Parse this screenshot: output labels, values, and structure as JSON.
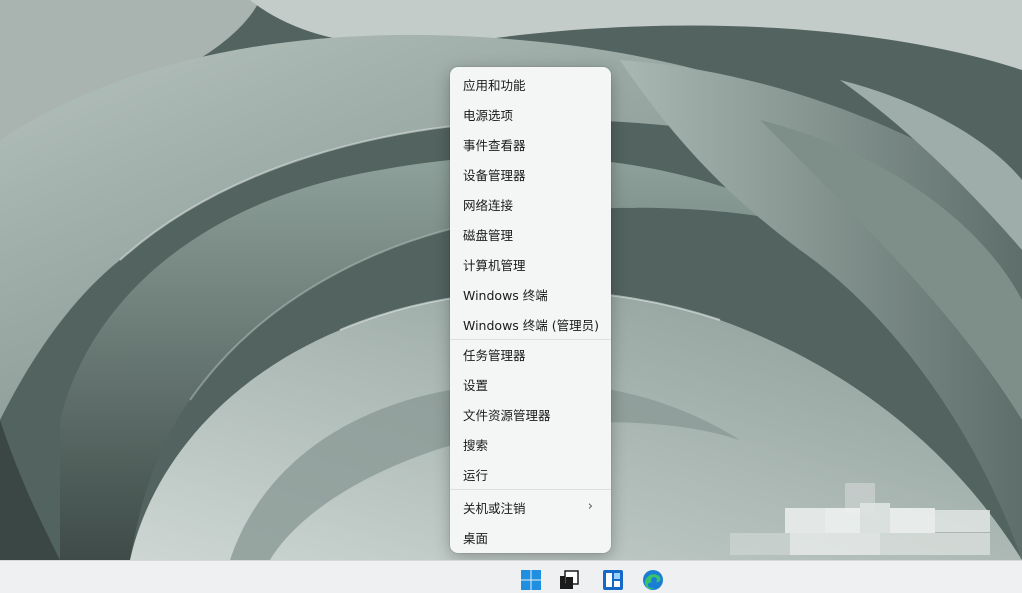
{
  "menu": {
    "items": [
      {
        "label": "应用和功能"
      },
      {
        "label": "电源选项"
      },
      {
        "label": "事件查看器"
      },
      {
        "label": "设备管理器"
      },
      {
        "label": "网络连接"
      },
      {
        "label": "磁盘管理"
      },
      {
        "label": "计算机管理"
      },
      {
        "label": "Windows 终端"
      },
      {
        "label": "Windows 终端 (管理员)"
      },
      {
        "label": "任务管理器"
      },
      {
        "label": "设置"
      },
      {
        "label": "文件资源管理器"
      },
      {
        "label": "搜索"
      },
      {
        "label": "运行"
      },
      {
        "label": "关机或注销",
        "submenu": "›"
      },
      {
        "label": "桌面"
      }
    ]
  },
  "annotation": {
    "color": "#e8231d"
  },
  "taskbar": {
    "icons": [
      "windows-start-icon",
      "task-view-icon",
      "widgets-icon",
      "edge-icon"
    ]
  },
  "colors": {
    "wallpaper_base": "#5f6f6b",
    "menu_bg": "#f4f6f5",
    "taskbar_bg": "#eef0f1",
    "start_blue": "#1f8fe0"
  }
}
